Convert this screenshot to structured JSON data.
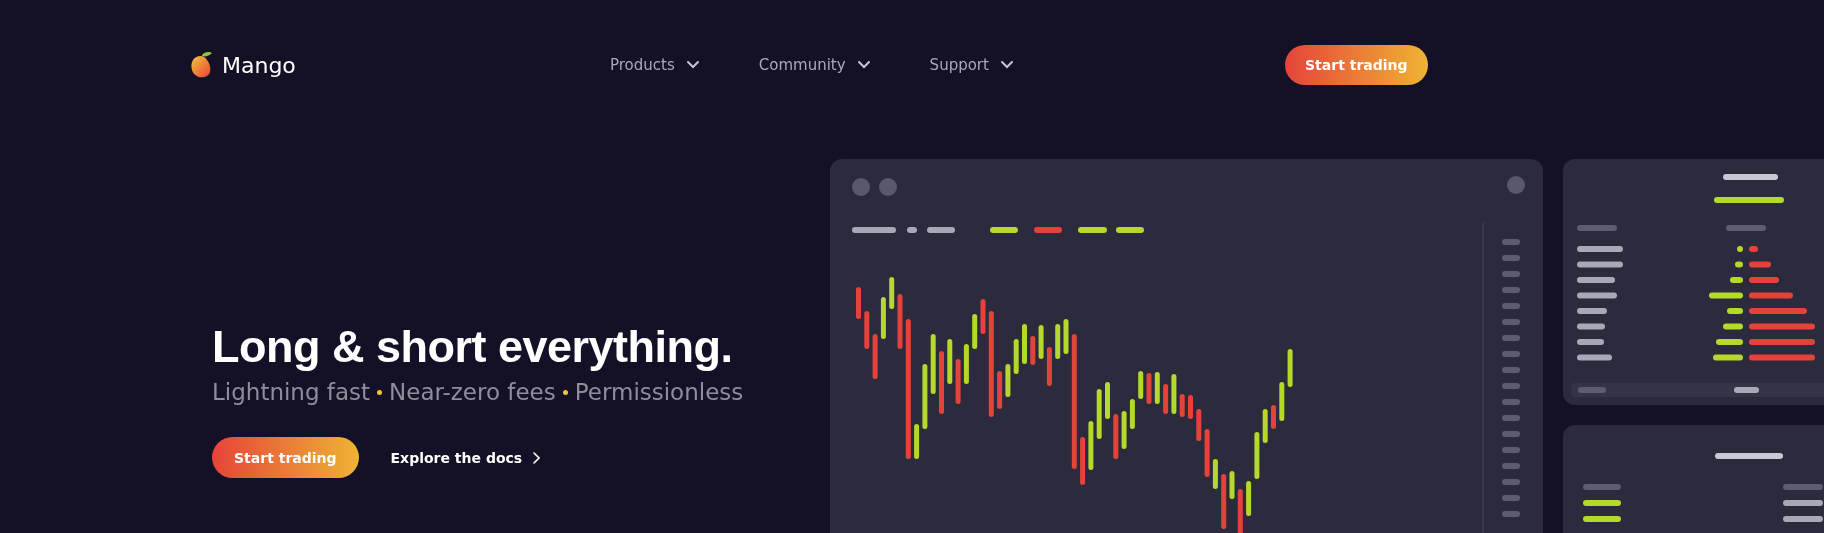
{
  "header": {
    "brand": "Mango",
    "nav": [
      {
        "label": "Products"
      },
      {
        "label": "Community"
      },
      {
        "label": "Support"
      }
    ],
    "cta": "Start trading"
  },
  "hero": {
    "headline": "Long & short everything.",
    "features": [
      "Lightning fast",
      "Near-zero fees",
      "Permissionless"
    ],
    "primary_button": "Start trading",
    "docs_link": "Explore the docs"
  }
}
